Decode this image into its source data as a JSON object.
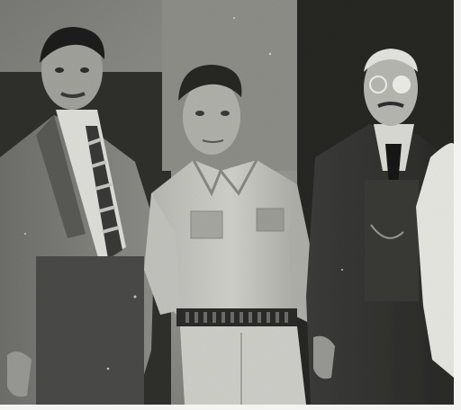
{
  "photo": {
    "subject": "three-men-portrait",
    "style": "black-and-white halftone print",
    "colors": {
      "paper": "#f4f4f2",
      "background_wall": "#8c8c88",
      "dark_tone": "#1c1c1c",
      "mid_tone": "#6a6a66",
      "light_tone": "#cfcfca"
    }
  }
}
